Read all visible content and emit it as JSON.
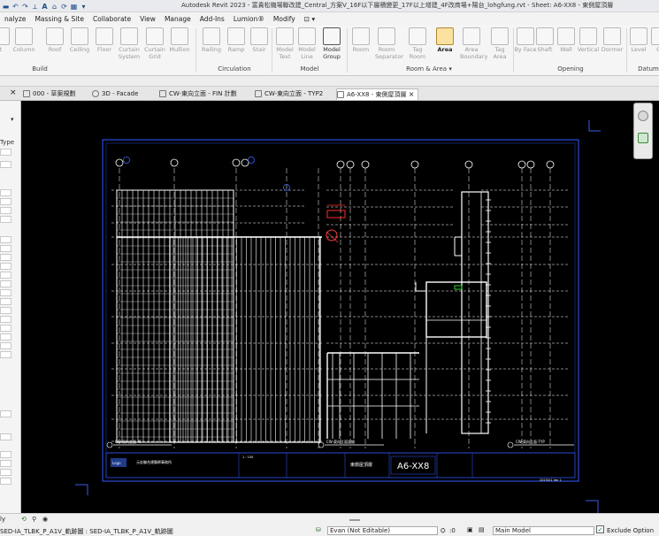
{
  "titlebar": {
    "title": "Autodesk Revit 2023 - 富貴松機場聯改建_Central_方案V_16F以下層積變更_17F以上增建_4F改商場+陽台_lohgfung.rvt - Sheet: A6-XX8 - 東側屋頂層",
    "qat_icons": [
      "save-icon",
      "undo-icon",
      "redo-icon",
      "measure-icon",
      "text-icon",
      "home-icon",
      "sync-icon",
      "view-switch-icon",
      "dropdown-icon"
    ]
  },
  "menu": [
    "nalyze",
    "Massing & Site",
    "Collaborate",
    "View",
    "Manage",
    "Add-Ins",
    "Lumion®",
    "Modify",
    "⊡ ▾"
  ],
  "ribbon": {
    "tools": [
      {
        "label": "t",
        "state": "disabled"
      },
      {
        "label": "Column",
        "state": "disabled"
      },
      {
        "label": "Roof",
        "state": "disabled"
      },
      {
        "label": "Ceiling",
        "state": "disabled"
      },
      {
        "label": "Floor",
        "state": "disabled"
      },
      {
        "label": "Curtain System",
        "state": "disabled"
      },
      {
        "label": "Curtain Grid",
        "state": "disabled"
      },
      {
        "label": "Mullion",
        "state": "disabled"
      },
      {
        "label": "Railing",
        "state": "disabled"
      },
      {
        "label": "Ramp",
        "state": "disabled"
      },
      {
        "label": "Stair",
        "state": "disabled"
      },
      {
        "label": "Model Text",
        "state": "disabled"
      },
      {
        "label": "Model Line",
        "state": "disabled"
      },
      {
        "label": "Model Group",
        "state": "enabled"
      },
      {
        "label": "Room",
        "state": "disabled"
      },
      {
        "label": "Room Separator",
        "state": "disabled"
      },
      {
        "label": "Tag Room",
        "state": "disabled"
      },
      {
        "label": "Area",
        "state": "active"
      },
      {
        "label": "Area Boundary",
        "state": "disabled"
      },
      {
        "label": "Tag Area",
        "state": "disabled"
      },
      {
        "label": "By Face",
        "state": "disabled"
      },
      {
        "label": "Shaft",
        "state": "disabled"
      },
      {
        "label": "Wall",
        "state": "disabled"
      },
      {
        "label": "Vertical",
        "state": "disabled"
      },
      {
        "label": "Dormer",
        "state": "disabled"
      },
      {
        "label": "Level",
        "state": "disabled"
      },
      {
        "label": "Gr",
        "state": "disabled"
      }
    ],
    "groups": [
      "Build",
      "Circulation",
      "Model",
      "Room & Area ▾",
      "Opening",
      "Datum"
    ]
  },
  "view_tabs": [
    {
      "label": "000 - 草案規劃",
      "active": false
    },
    {
      "label": "3D - Facade",
      "active": false
    },
    {
      "label": "CW-東向立面 - FIN 計劃",
      "active": false
    },
    {
      "label": "CW-東向立面 - TYP2",
      "active": false
    },
    {
      "label": "A6-XX8 - 東側屋頂層",
      "active": true
    }
  ],
  "tab_close": "×",
  "left_panel": {
    "type_label": "Type",
    "stripe_marks": [
      "▾",
      "x",
      "x",
      "x",
      "x",
      "x",
      "x"
    ]
  },
  "sheet": {
    "number": "A6-XX8",
    "name": "東側屋頂層",
    "company": "元宏聯合建築師事務所",
    "company_logo_text": "Logo",
    "scale_note_1": "1 : 100",
    "date_note": "2023/01 Ver 1",
    "view_titles": [
      "CW-東向立面-4F",
      "CW-東向立面詳細",
      "CW-東向立面-TYP"
    ],
    "grid_bubbles_left": [
      "⑧",
      "⑨",
      "⑩",
      "⑪"
    ],
    "grid_bubbles_mid": [
      "⑤",
      "⑥",
      "⑦",
      "⑧",
      "⑨"
    ],
    "grid_bubbles_right": [
      "②",
      "③",
      "④"
    ]
  },
  "status": {
    "left_text": "ly",
    "left_icons": [
      "worksharing-icon",
      "filter-icon",
      "camera-icon"
    ],
    "bottom_left": "SED-IA_TLBK_P_A1V_軌跡圖 : SED-IA_TLBK_P_A1V_軌跡圖",
    "editor": "Evan (Not Editable)",
    "zero_count": ":0",
    "model_select": "Main Model",
    "exclude_options": "Exclude Option",
    "progress": 0
  }
}
